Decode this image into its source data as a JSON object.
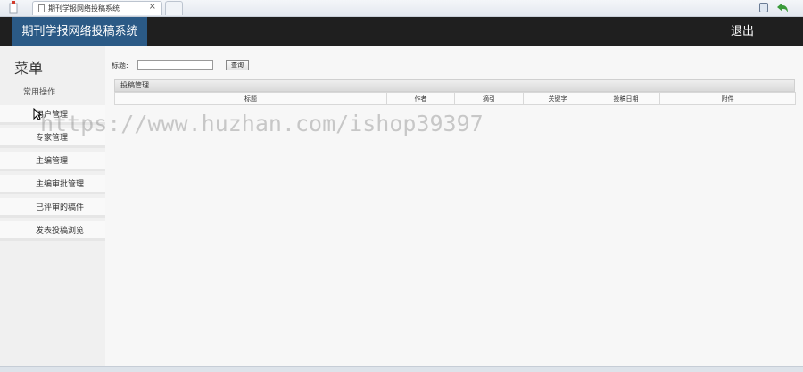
{
  "browser": {
    "tab_title": "期刊学报网络投稿系统",
    "tab_close": "×"
  },
  "header": {
    "brand": "期刊学报网络投稿系统",
    "logout": "退出"
  },
  "sidebar": {
    "title": "菜单",
    "group": "常用操作",
    "items": [
      {
        "label": "用户管理"
      },
      {
        "label": "专家管理"
      },
      {
        "label": "主编管理"
      },
      {
        "label": "主编审批管理"
      },
      {
        "label": "已评审的稿件"
      },
      {
        "label": "发表投稿浏览"
      }
    ]
  },
  "search": {
    "label": "标题:",
    "value": "",
    "button": "查询"
  },
  "panel": {
    "title": "投稿管理",
    "columns": [
      "标题",
      "作者",
      "摘引",
      "关键字",
      "投稿日期",
      "附件"
    ]
  },
  "watermark": "https://www.huzhan.com/ishop39397",
  "colors": {
    "header_bg": "#1f1f1f",
    "brand_bg": "#2b5a86",
    "sidebar_bg": "#f0f0f0"
  }
}
